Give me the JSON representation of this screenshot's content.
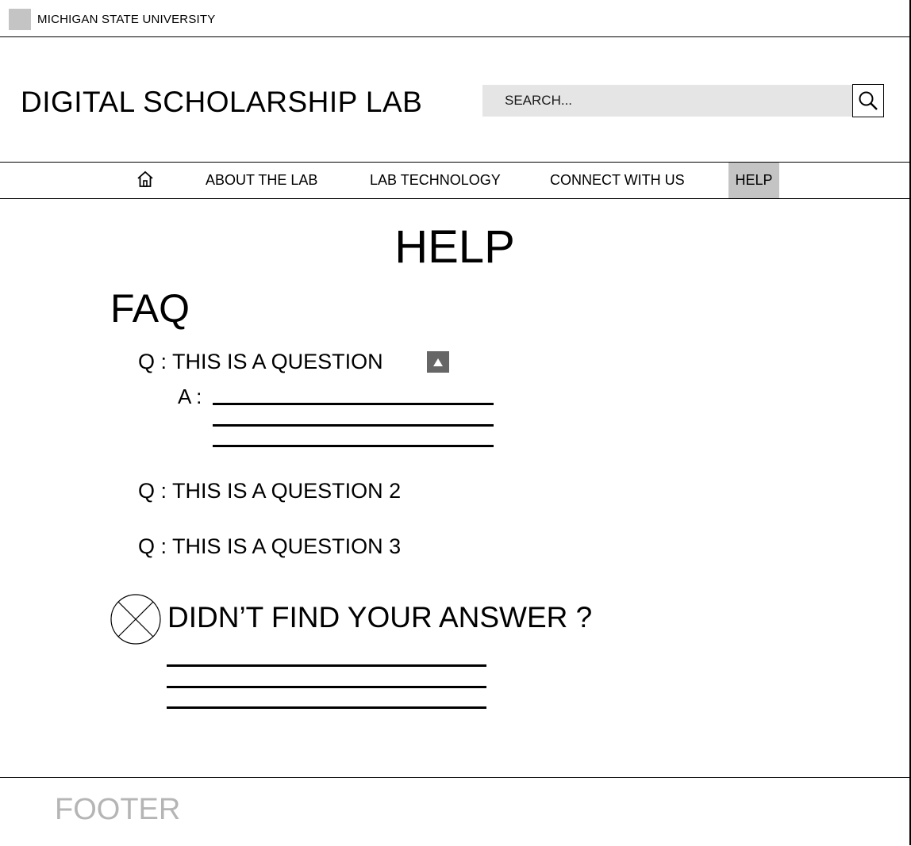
{
  "topbar": {
    "university": "MICHIGAN STATE UNIVERSITY"
  },
  "header": {
    "site_title": "DIGITAL SCHOLARSHIP LAB",
    "search_placeholder": "SEARCH..."
  },
  "nav": {
    "home_icon": "home-icon",
    "items": [
      {
        "label": "ABOUT THE LAB"
      },
      {
        "label": "LAB TECHNOLOGY"
      },
      {
        "label": "CONNECT WITH US"
      },
      {
        "label": "HELP",
        "active": true
      }
    ],
    "active_color": "#c4c4c4"
  },
  "main": {
    "page_title": "HELP",
    "faq_title": "FAQ",
    "faqs": [
      {
        "question": "Q : THIS IS A QUESTION",
        "answer_label": "A :",
        "expanded": true
      },
      {
        "question": "Q : THIS IS A QUESTION 2",
        "expanded": false
      },
      {
        "question": "Q : THIS IS A QUESTION 3",
        "expanded": false
      }
    ],
    "not_found_heading": "DIDN’T FIND YOUR ANSWER ?"
  },
  "footer": {
    "label": "FOOTER"
  }
}
